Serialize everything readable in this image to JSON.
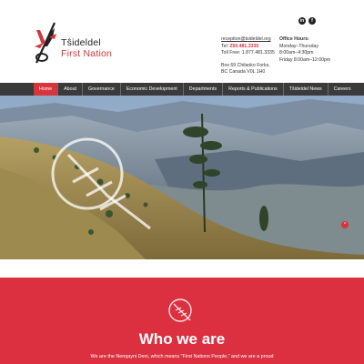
{
  "brand": {
    "name_line1": "Tŝideldel",
    "name_line2": "First Nation",
    "accent_color": "#d8343b"
  },
  "contact": {
    "email": "reception@tsideldel.org",
    "tel_label": "Tel:",
    "tel_number": "250.481.3335",
    "tollfree": "Toll Free: 1.877.481.3335",
    "address_line1": "Box 69 Chilanko Forks,",
    "address_line2": "BC Canada V0L 1H0"
  },
  "hours": {
    "title": "Office Hours:",
    "line1": "Monday–Thursday",
    "line2": "8:00am–4:30pm",
    "line3": "Friday 8:00am–12:00pm"
  },
  "social": {
    "linkedin_icon": "linkedin-icon",
    "linkedin_label": "in",
    "facebook_icon": "facebook-icon",
    "facebook_label": "f"
  },
  "nav": {
    "items": [
      {
        "label": "Home",
        "active": true
      },
      {
        "label": "About"
      },
      {
        "label": "Governance"
      },
      {
        "label": "Economic Development"
      },
      {
        "label": "Departments"
      },
      {
        "label": "Reports & Publications"
      },
      {
        "label": "Tŝideldel News"
      },
      {
        "label": "Careers"
      }
    ]
  },
  "hero": {
    "image": "canyon-landscape-with-pine-tree",
    "scroll_up_label": "^"
  },
  "who": {
    "icon": "feather-icon",
    "title": "Who we are",
    "text": "We are the Nenqayni Deni, which means \"First Nations People,\" and we are a proud"
  }
}
